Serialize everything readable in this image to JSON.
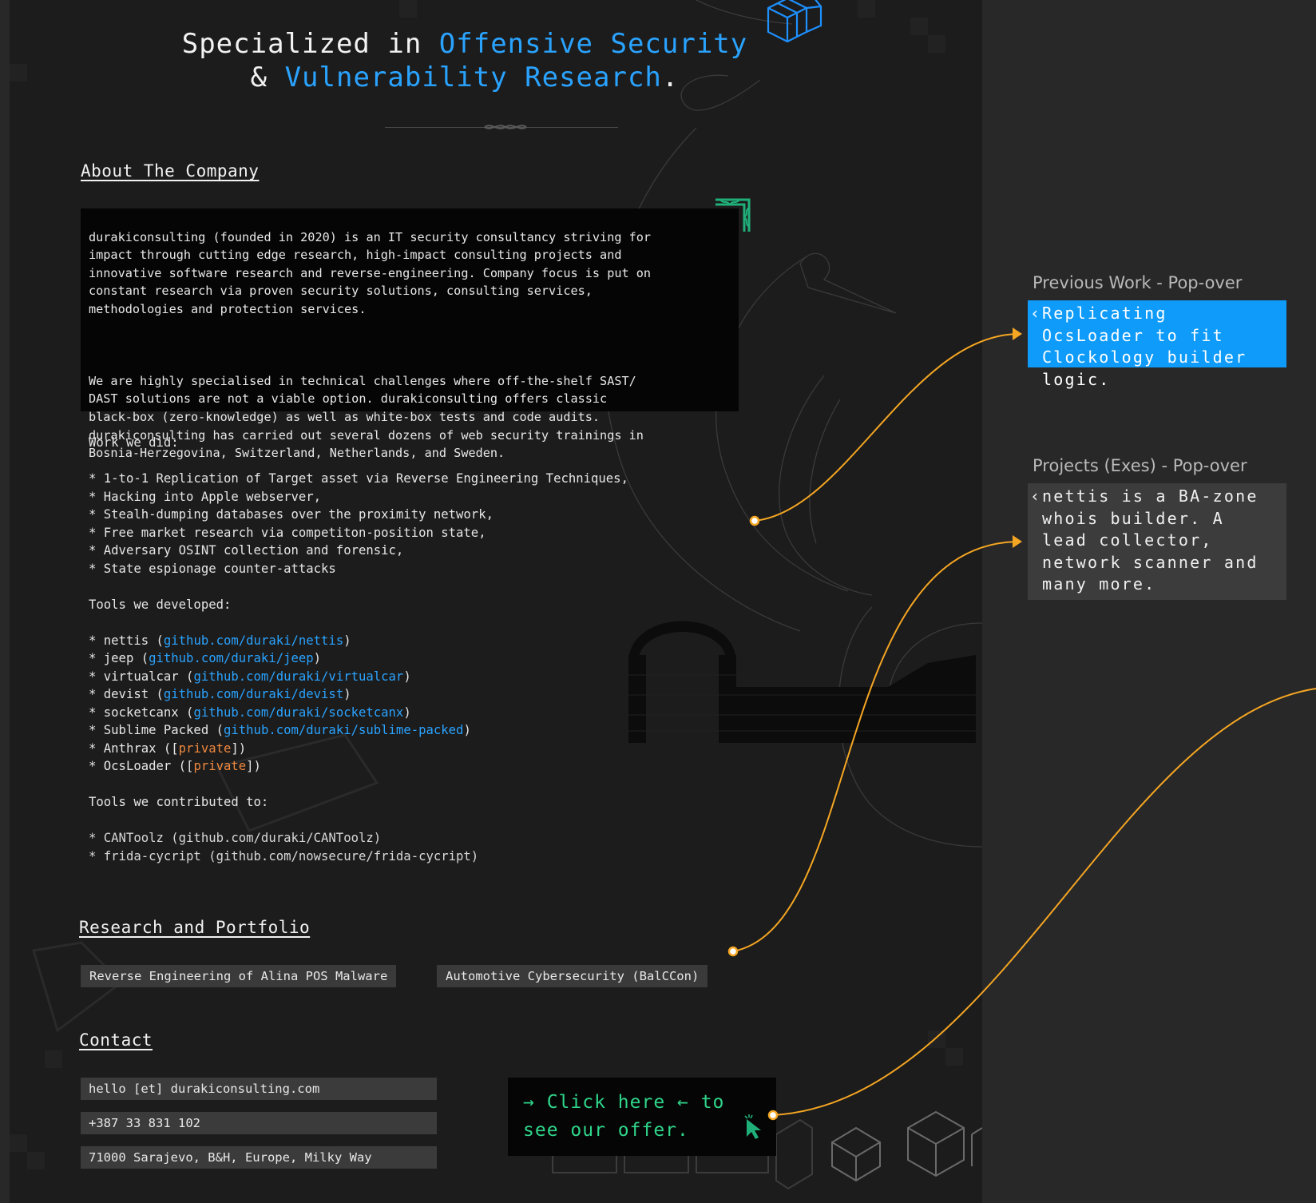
{
  "colors": {
    "accent_blue": "#2aa3ff",
    "popover_blue": "#0f9bfa",
    "private_orange": "#f0883e",
    "offer_green": "#2fd58a",
    "connector_orange": "#f5a623"
  },
  "hero": {
    "line1_prefix": "Specialized in ",
    "line1_highlight": "Offensive Security",
    "line2_prefix": "& ",
    "line2_highlight": "Vulnerability Research",
    "line2_suffix": "."
  },
  "about": {
    "heading": "About The Company",
    "para1": "durakiconsulting (founded in 2020) is an IT security consultancy striving for\nimpact through cutting edge research, high-impact consulting projects and\ninnovative software research and reverse-engineering. Company focus is put on\nconstant research via proven security solutions, consulting services,\nmethodologies and protection services.",
    "para2": "We are highly specialised in technical challenges where off-the-shelf SAST/\nDAST solutions are not a viable option. durakiconsulting offers classic\nblack-box (zero-knowledge) as well as white-box tests and code audits.\ndurakiconsulting has carried out several dozens of web security trainings in\nBosnia-Herzegovina, Switzerland, Netherlands, and Sweden."
  },
  "work": {
    "heading": "Work we did:",
    "items": [
      "* 1-to-1 Replication of Target asset via Reverse Engineering Techniques,",
      "* Hacking into Apple webserver,",
      "* Stealh-dumping databases over the proximity network,",
      "* Free market research via competiton-position state,",
      "* Adversary OSINT collection and forensic,",
      "* State espionage counter-attacks"
    ]
  },
  "tools": {
    "heading": "Tools we developed:",
    "items": [
      {
        "name": "* nettis (",
        "link": "github.com/duraki/nettis",
        "end": ")"
      },
      {
        "name": "* jeep (",
        "link": "github.com/duraki/jeep",
        "end": ")"
      },
      {
        "name": "* virtualcar (",
        "link": "github.com/duraki/virtualcar",
        "end": ")"
      },
      {
        "name": "* devist (",
        "link": "github.com/duraki/devist",
        "end": ")"
      },
      {
        "name": "* socketcanx (",
        "link": "github.com/duraki/socketcanx",
        "end": ")"
      },
      {
        "name": "* Sublime Packed (",
        "link": "github.com/duraki/sublime-packed",
        "end": ")"
      }
    ],
    "private_items": [
      {
        "name": "* Anthrax ([",
        "label": "private",
        "end": "])"
      },
      {
        "name": "* OcsLoader ([",
        "label": "private",
        "end": "])"
      }
    ]
  },
  "contributed": {
    "heading": "Tools we contributed to:",
    "items": [
      "* CANToolz (github.com/duraki/CANToolz)",
      "* frida-cycript (github.com/nowsecure/frida-cycript)"
    ]
  },
  "research": {
    "heading": "Research and Portfolio",
    "tags": [
      "Reverse Engineering of Alina POS Malware",
      "Automotive Cybersecurity (BalCCon)"
    ]
  },
  "contact": {
    "heading": "Contact",
    "email": "hello [et] durakiconsulting.com",
    "phone": "+387 33 831 102",
    "address": "71000 Sarajevo, B&H, Europe, Milky Way"
  },
  "offer": {
    "line1": "→ Click here ← to",
    "line2": "see our offer."
  },
  "popovers": {
    "previous_work": {
      "label": "Previous Work - Pop-over",
      "text": "Replicating OcsLoader to fit Clockology builder logic."
    },
    "projects": {
      "label": "Projects (Exes) - Pop-over",
      "text": "nettis is a BA-zone whois builder. A lead collector, network scanner and many more."
    }
  },
  "icons": [
    "cube-icon",
    "celtic-knot-icon",
    "chevron-left-icon",
    "cursor-icon"
  ]
}
